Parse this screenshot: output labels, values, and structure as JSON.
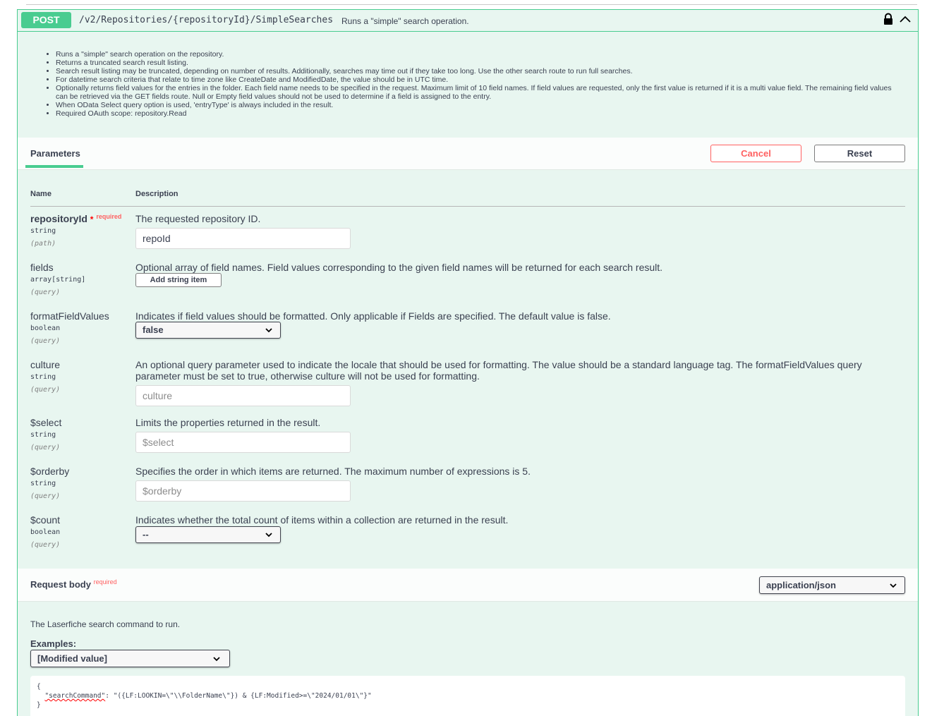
{
  "operation": {
    "method": "POST",
    "path": "/v2/Repositories/{repositoryId}/SimpleSearches",
    "summary": "Runs a \"simple\" search operation.",
    "icons": [
      "lock-icon",
      "chevron-up-icon"
    ]
  },
  "description_items": [
    "Runs a \"simple\" search operation on the repository.",
    "Returns a truncated search result listing.",
    "Search result listing may be truncated, depending on number of results. Additionally, searches may time out if they take too long. Use the other search route to run full searches.",
    "For datetime search criteria that relate to time zone like CreateDate and ModifiedDate, the value should be in UTC time.",
    "Optionally returns field values for the entries in the folder. Each field name needs to be specified in the request. Maximum limit of 10 field names. If field values are requested, only the first value is returned if it is a multi value field. The remaining field values can be retrieved via the GET fields route. Null or Empty field values should not be used to determine if a field is assigned to the entry.",
    "When OData Select query option is used, 'entryType' is always included in the result.",
    "Required OAuth scope: repository.Read"
  ],
  "params_section": {
    "tab_label": "Parameters",
    "cancel_label": "Cancel",
    "reset_label": "Reset",
    "col_name": "Name",
    "col_description": "Description"
  },
  "params": {
    "repositoryId": {
      "name": "repositoryId",
      "required_star": "*",
      "required_label": "required",
      "type": "string",
      "in": "(path)",
      "description": "The requested repository ID.",
      "value": "repoId"
    },
    "fields": {
      "name": "fields",
      "type": "array[string]",
      "in": "(query)",
      "description": "Optional array of field names. Field values corresponding to the given field names will be returned for each search result.",
      "add_label": "Add string item"
    },
    "formatFieldValues": {
      "name": "formatFieldValues",
      "type": "boolean",
      "in": "(query)",
      "description": "Indicates if field values should be formatted. Only applicable if Fields are specified. The default value is false.",
      "selected": "false"
    },
    "culture": {
      "name": "culture",
      "type": "string",
      "in": "(query)",
      "description": "An optional query parameter used to indicate the locale that should be used for formatting. The value should be a standard language tag. The formatFieldValues query parameter must be set to true, otherwise culture will not be used for formatting.",
      "placeholder": "culture"
    },
    "select": {
      "name": "$select",
      "type": "string",
      "in": "(query)",
      "description": "Limits the properties returned in the result.",
      "placeholder": "$select"
    },
    "orderby": {
      "name": "$orderby",
      "type": "string",
      "in": "(query)",
      "description": "Specifies the order in which items are returned. The maximum number of expressions is 5.",
      "placeholder": "$orderby"
    },
    "count": {
      "name": "$count",
      "type": "boolean",
      "in": "(query)",
      "description": "Indicates whether the total count of items within a collection are returned in the result.",
      "selected": "--"
    }
  },
  "request_body": {
    "title": "Request body",
    "required_label": "required",
    "content_type": "application/json",
    "description": "The Laserfiche search command to run.",
    "examples_label": "Examples:",
    "example_selected": "[Modified value]",
    "code_open": "{",
    "code_key": "\"searchCommand\"",
    "code_value": "\"({LF:LOOKIN=\\\"\\\\FolderName\\\"}) & {LF:Modified>=\\\"2024/01/01\\\"}\"",
    "code_close": "}"
  },
  "colors": {
    "post_green": "#49cc90",
    "block_bg": "#e8f6f0",
    "cancel_red": "#ff6060",
    "annotation_red": "#e00000"
  }
}
